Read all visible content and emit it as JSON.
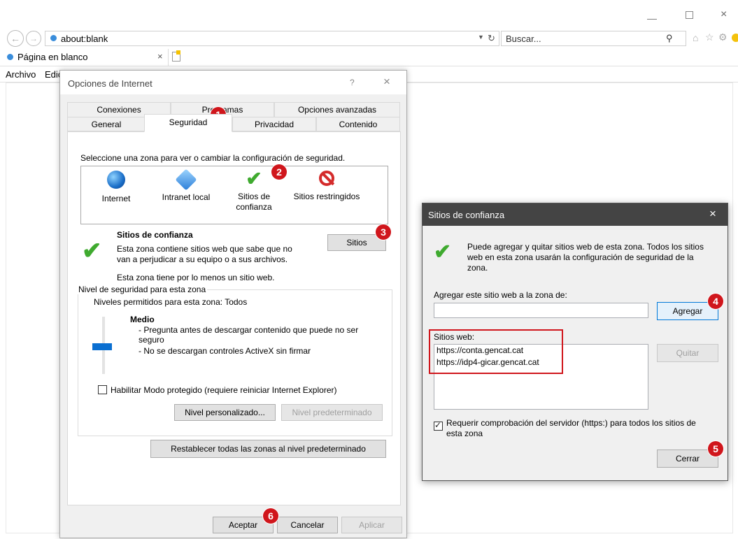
{
  "browser": {
    "address": "about:blank",
    "search_placeholder": "Buscar...",
    "tab_title": "Página en blanco",
    "menu": [
      "Archivo",
      "Edic"
    ]
  },
  "internet_options": {
    "title": "Opciones de Internet",
    "help": "?",
    "close": "×",
    "tabs_row1": [
      "Conexiones",
      "Programas",
      "Opciones avanzadas"
    ],
    "tabs_row2": [
      "General",
      "Seguridad",
      "Privacidad",
      "Contenido"
    ],
    "zone_prompt": "Seleccione una zona para ver o cambiar la configuración de seguridad.",
    "zones": [
      {
        "label": "Internet",
        "icon": "globe-icon"
      },
      {
        "label": "Intranet local",
        "icon": "intranet-icon"
      },
      {
        "label": "Sitios de\nconfianza",
        "icon": "checkmark-icon"
      },
      {
        "label": "Sitios restringidos",
        "icon": "restricted-icon"
      }
    ],
    "zone_title": "Sitios de confianza",
    "zone_desc": "Esta zona contiene sitios web que sabe que no van a perjudicar a su equipo o a sus archivos.",
    "zone_has_sites": "Esta zona tiene por lo menos un sitio web.",
    "sites_button": "Sitios",
    "security_level_group": "Nivel de seguridad para esta zona",
    "allowed_levels": "Niveles permitidos para esta zona: Todos",
    "level_name": "Medio",
    "level_bullet1": "- Pregunta antes de descargar contenido que puede no ser seguro",
    "level_bullet2": "- No se descargan controles ActiveX sin firmar",
    "protected_mode": "Habilitar Modo protegido (requiere reiniciar Internet Explorer)",
    "custom_level": "Nivel personalizado...",
    "default_level": "Nivel predeterminado",
    "reset_all": "Restablecer todas las zonas al nivel predeterminado",
    "ok": "Aceptar",
    "cancel": "Cancelar",
    "apply": "Aplicar"
  },
  "trusted_sites": {
    "title": "Sitios de confianza",
    "close": "×",
    "info": "Puede agregar y quitar sitios web de esta zona. Todos los sitios web en esta zona usarán la configuración de seguridad de la zona.",
    "add_label": "Agregar este sitio web a la zona de:",
    "add_value": "",
    "add_button": "Agregar",
    "websites_label": "Sitios web:",
    "websites": [
      "https://conta.gencat.cat",
      "https://idp4-gicar.gencat.cat"
    ],
    "remove_button": "Quitar",
    "require_https": "Requerir comprobación del servidor (https:) para todos los sitios de esta zona",
    "close_button": "Cerrar"
  },
  "markers": [
    "1",
    "2",
    "3",
    "4",
    "5",
    "6"
  ]
}
